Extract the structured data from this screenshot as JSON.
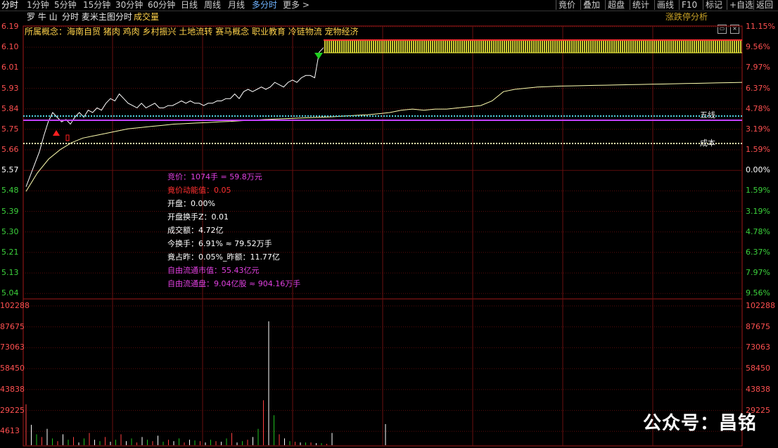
{
  "toolbar": {
    "periods": [
      "分时",
      "1分钟",
      "5分钟",
      "15分钟",
      "30分钟",
      "60分钟",
      "日线",
      "周线",
      "月线",
      "多分时",
      "更多 >"
    ],
    "right_buttons": [
      "竟价",
      "叠加",
      "超盘",
      "统计",
      "画线",
      "F10",
      "标记",
      "+自选",
      "返回"
    ]
  },
  "header": {
    "stock_name": "罗 牛 山",
    "subtitle": "分时 麦米主图分时",
    "indicator": "成交量",
    "limit_analysis": "涨跌停分析"
  },
  "concepts": "所属概念：海南自贸 猪肉 鸡肉 乡村振兴 土地流转 赛马概念 职业教育 冷链物流 宠物经济",
  "price_axis": {
    "left": [
      "6.19",
      "6.10",
      "6.01",
      "5.93",
      "5.84",
      "5.75",
      "5.66",
      "5.57",
      "5.48",
      "5.39",
      "5.30",
      "5.21",
      "5.13",
      "5.04"
    ],
    "right": [
      "11.15%",
      "9.56%",
      "7.97%",
      "6.37%",
      "4.78%",
      "3.19%",
      "1.59%",
      "0.00%",
      "1.59%",
      "3.19%",
      "4.78%",
      "6.37%",
      "7.97%",
      "9.56%"
    ]
  },
  "volume_axis": {
    "labels": [
      "102288",
      "87675",
      "73063",
      "58450",
      "43838",
      "29225",
      "4613"
    ],
    "right_labels": [
      "102288",
      "87675",
      "73063",
      "58450",
      "43838",
      "29225",
      ""
    ]
  },
  "lines": {
    "wuxian": "五线",
    "chengben": "成本"
  },
  "info": {
    "jingjia": "竞价：1074手 = 59.8万元",
    "jingjia_energy": "竟价动能值：0.05",
    "open": "开盘：0.00%",
    "open_turnover": "开盘换手Z：0.01",
    "amount": "成交额：4.72亿",
    "turnover": "今换手：6.91% ≈ 79.52万手",
    "jingzhan": "竟占昨：0.05%_昨额：11.77亿",
    "float_mv": "自由流通市值：55.43亿元",
    "float_shares": "自由流通盘：9.04亿股 ≈ 904.16万手"
  },
  "watermark": "公众号：昌铭",
  "chart_data": {
    "type": "line",
    "prev_close": 5.57,
    "ylim": [
      4.98,
      6.19
    ],
    "series": [
      {
        "values": [
          5.5,
          5.55,
          5.6,
          5.65,
          5.72,
          5.78,
          5.82,
          5.8,
          5.78,
          5.79,
          5.77,
          5.8,
          5.82,
          5.8,
          5.83,
          5.82,
          5.84,
          5.83,
          5.86,
          5.88,
          5.87,
          5.9,
          5.88,
          5.86,
          5.85,
          5.84,
          5.86,
          5.84,
          5.85,
          5.86,
          5.84,
          5.84,
          5.85,
          5.85,
          5.86,
          5.87,
          5.86,
          5.87,
          5.86,
          5.86,
          5.85,
          5.86,
          5.86,
          5.87,
          5.87,
          5.88,
          5.88,
          5.9,
          5.88,
          5.91,
          5.92,
          5.91,
          5.92,
          5.93,
          5.92,
          5.93,
          5.95,
          5.94,
          5.93,
          5.95,
          5.96,
          5.95,
          5.97,
          5.98,
          5.98,
          5.97,
          6.08,
          6.1
        ]
      },
      {
        "values": [
          5.48,
          5.56,
          5.62,
          5.66,
          5.69,
          5.71,
          5.72,
          5.73,
          5.74,
          5.75,
          5.755,
          5.76,
          5.765,
          5.77,
          5.772,
          5.775,
          5.777,
          5.78,
          5.782,
          5.785,
          5.787,
          5.79,
          5.792,
          5.794,
          5.796,
          5.798,
          5.8,
          5.802,
          5.805,
          5.808,
          5.81,
          5.815,
          5.82,
          5.83,
          5.835,
          5.83,
          5.835,
          5.835,
          5.84,
          5.845,
          5.85,
          5.87,
          5.91,
          5.92,
          5.925,
          5.93,
          5.932,
          5.934,
          5.935,
          5.936,
          5.937,
          5.938,
          5.939,
          5.94,
          5.941,
          5.942,
          5.943,
          5.944,
          5.945,
          5.946,
          5.947,
          5.948,
          5.949,
          5.95
        ]
      }
    ],
    "volume": [
      30000,
      15000,
      8000,
      6000,
      12000,
      5000,
      3000,
      8000,
      4000,
      6000,
      2000,
      5000,
      9000,
      4000,
      3000,
      6000,
      2500,
      4000,
      8000,
      3000,
      5000,
      2000,
      6000,
      4000,
      3000,
      7000,
      2500,
      4000,
      3000,
      5000,
      2000,
      4000,
      3500,
      3000,
      2000,
      4000,
      3000,
      2500,
      5000,
      9000,
      2000,
      3000,
      4000,
      6000,
      12000,
      33000,
      91000,
      22000,
      8000,
      5000,
      3000,
      2500,
      2000,
      2000,
      2000,
      1500,
      1500,
      1000,
      9000
    ]
  }
}
